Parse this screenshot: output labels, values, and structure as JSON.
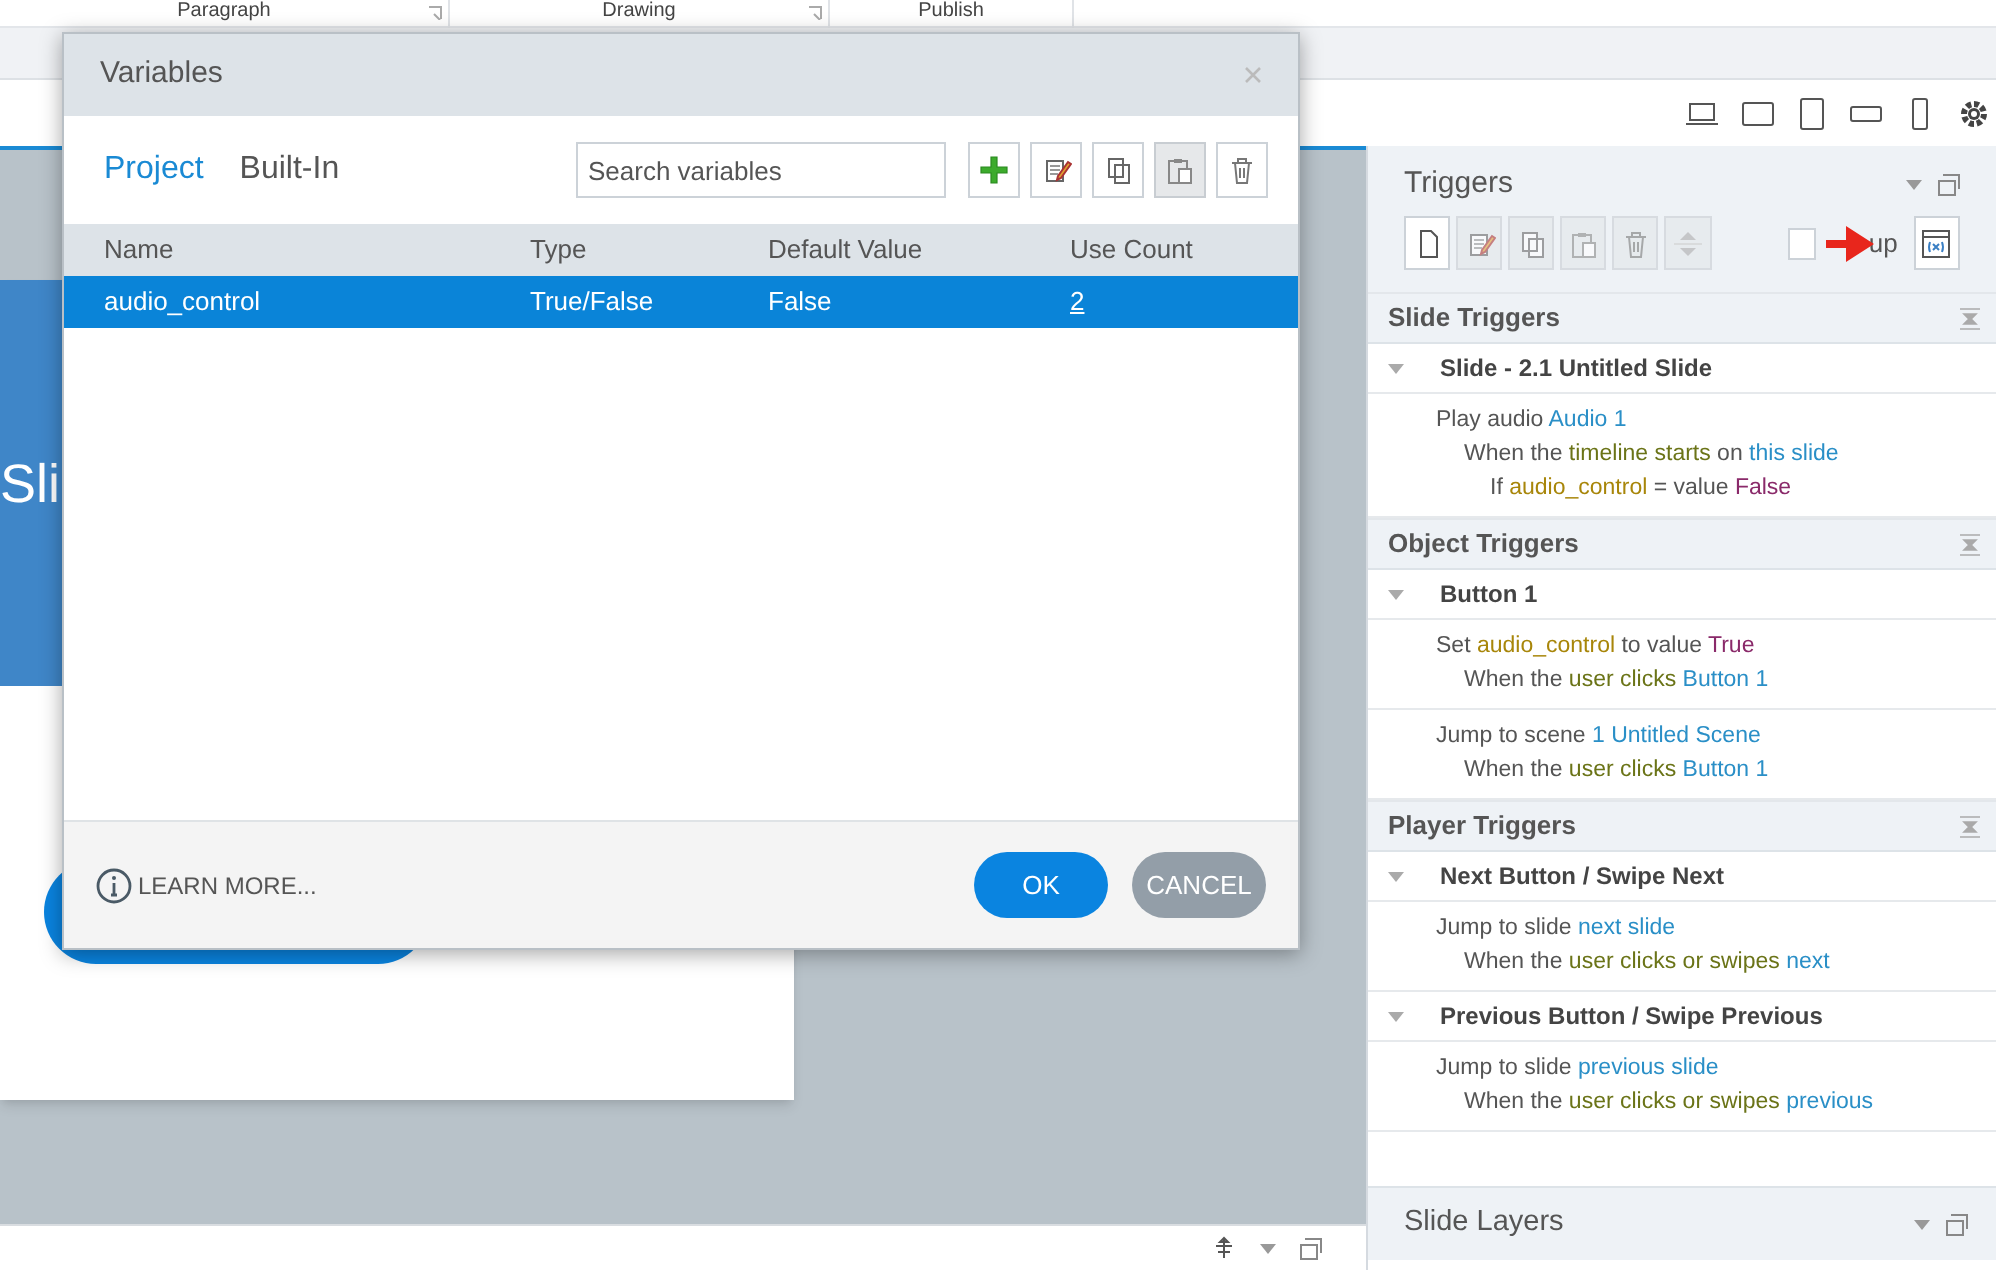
{
  "ribbon": {
    "groups": [
      {
        "label": "Paragraph"
      },
      {
        "label": "Drawing"
      },
      {
        "label": "Publish"
      }
    ]
  },
  "slide": {
    "title": "Sli"
  },
  "dialog": {
    "title": "Variables",
    "tabs": [
      {
        "label": "Project",
        "selected": true
      },
      {
        "label": "Built-In",
        "selected": false
      }
    ],
    "search": {
      "placeholder": "Search variables"
    },
    "toolbar": [
      {
        "kind": "add",
        "disabled": false
      },
      {
        "kind": "edit",
        "disabled": false
      },
      {
        "kind": "copy",
        "disabled": false
      },
      {
        "kind": "paste",
        "disabled": true
      },
      {
        "kind": "delete",
        "disabled": false
      }
    ],
    "table": {
      "columns": [
        "Name",
        "Type",
        "Default Value",
        "Use Count"
      ],
      "rows": [
        {
          "cells": [
            "audio_control",
            "True/False",
            "False",
            "2"
          ],
          "selected": true
        }
      ]
    },
    "learn_more": "LEARN MORE...",
    "buttons": [
      {
        "label": "OK",
        "kind": "primary"
      },
      {
        "label": "CANCEL",
        "kind": "secondary"
      }
    ]
  },
  "triggers_panel": {
    "title": "Triggers",
    "toolbar": [
      {
        "kind": "new",
        "disabled": false
      },
      {
        "kind": "edit",
        "disabled": true
      },
      {
        "kind": "copy",
        "disabled": true
      },
      {
        "kind": "paste",
        "disabled": true
      },
      {
        "kind": "delete",
        "disabled": true
      },
      {
        "kind": "move",
        "disabled": true
      }
    ],
    "group_option": {
      "label": "up",
      "checked": false
    },
    "sections": [
      {
        "title": "Slide Triggers",
        "groups": [
          {
            "title": "Slide - 2.1 Untitled Slide",
            "triggers": [
              {
                "lines": [
                  {
                    "kind": "action",
                    "parts": [
                      {
                        "kind": "text",
                        "text": "Play audio "
                      },
                      {
                        "kind": "object",
                        "text": "Audio 1"
                      }
                    ]
                  },
                  {
                    "kind": "when",
                    "parts": [
                      {
                        "kind": "text",
                        "text": "When the "
                      },
                      {
                        "kind": "event",
                        "text": "timeline starts"
                      },
                      {
                        "kind": "text",
                        "text": " on "
                      },
                      {
                        "kind": "object",
                        "text": "this slide"
                      }
                    ]
                  },
                  {
                    "kind": "if",
                    "parts": [
                      {
                        "kind": "text",
                        "text": "If "
                      },
                      {
                        "kind": "variable",
                        "text": "audio_control"
                      },
                      {
                        "kind": "text",
                        "text": " = value "
                      },
                      {
                        "kind": "value",
                        "text": "False"
                      }
                    ]
                  }
                ]
              }
            ]
          }
        ]
      },
      {
        "title": "Object Triggers",
        "groups": [
          {
            "title": "Button 1",
            "triggers": [
              {
                "lines": [
                  {
                    "kind": "action",
                    "parts": [
                      {
                        "kind": "text",
                        "text": "Set "
                      },
                      {
                        "kind": "variable",
                        "text": "audio_control"
                      },
                      {
                        "kind": "text",
                        "text": " to value "
                      },
                      {
                        "kind": "value",
                        "text": "True"
                      }
                    ]
                  },
                  {
                    "kind": "when",
                    "parts": [
                      {
                        "kind": "text",
                        "text": "When the "
                      },
                      {
                        "kind": "event",
                        "text": "user clicks"
                      },
                      {
                        "kind": "object",
                        "text": " Button 1"
                      }
                    ]
                  }
                ]
              },
              {
                "lines": [
                  {
                    "kind": "action",
                    "parts": [
                      {
                        "kind": "text",
                        "text": "Jump to scene "
                      },
                      {
                        "kind": "object",
                        "text": "1 Untitled Scene"
                      }
                    ]
                  },
                  {
                    "kind": "when",
                    "parts": [
                      {
                        "kind": "text",
                        "text": "When the "
                      },
                      {
                        "kind": "event",
                        "text": "user clicks"
                      },
                      {
                        "kind": "object",
                        "text": " Button 1"
                      }
                    ]
                  }
                ]
              }
            ]
          }
        ]
      },
      {
        "title": "Player Triggers",
        "groups": [
          {
            "title": "Next Button / Swipe Next",
            "triggers": [
              {
                "lines": [
                  {
                    "kind": "action",
                    "parts": [
                      {
                        "kind": "text",
                        "text": "Jump to slide "
                      },
                      {
                        "kind": "object",
                        "text": "next slide"
                      }
                    ]
                  },
                  {
                    "kind": "when",
                    "parts": [
                      {
                        "kind": "text",
                        "text": "When the "
                      },
                      {
                        "kind": "event",
                        "text": "user clicks or swipes"
                      },
                      {
                        "kind": "object",
                        "text": " next"
                      }
                    ]
                  }
                ]
              }
            ]
          },
          {
            "title": "Previous Button / Swipe Previous",
            "triggers": [
              {
                "lines": [
                  {
                    "kind": "action",
                    "parts": [
                      {
                        "kind": "text",
                        "text": "Jump to slide "
                      },
                      {
                        "kind": "object",
                        "text": "previous slide"
                      }
                    ]
                  },
                  {
                    "kind": "when",
                    "parts": [
                      {
                        "kind": "text",
                        "text": "When the "
                      },
                      {
                        "kind": "event",
                        "text": "user clicks or swipes"
                      },
                      {
                        "kind": "object",
                        "text": " previous"
                      }
                    ]
                  }
                ]
              }
            ]
          }
        ]
      }
    ]
  },
  "layers_panel": {
    "title": "Slide Layers"
  }
}
